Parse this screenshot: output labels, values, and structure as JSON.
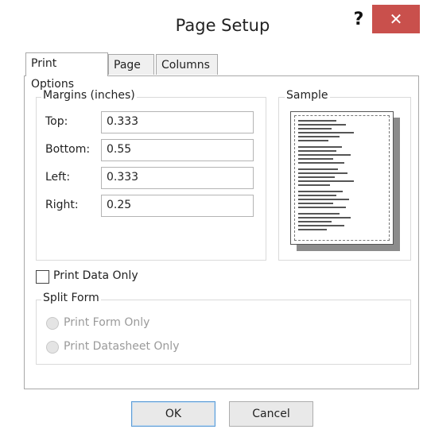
{
  "window": {
    "title": "Page Setup",
    "help_label": "?",
    "close_label": "✕"
  },
  "tabs": [
    {
      "label": "Print Options",
      "active": true
    },
    {
      "label": "Page",
      "active": false
    },
    {
      "label": "Columns",
      "active": false
    }
  ],
  "margins": {
    "group_label": "Margins (inches)",
    "fields": [
      {
        "label": "Top:",
        "value": "0.333"
      },
      {
        "label": "Bottom:",
        "value": "0.55"
      },
      {
        "label": "Left:",
        "value": "0.333"
      },
      {
        "label": "Right:",
        "value": "0.25"
      }
    ]
  },
  "sample": {
    "group_label": "Sample"
  },
  "print_data_only": {
    "label": "Print Data Only",
    "checked": false
  },
  "split_form": {
    "group_label": "Split Form",
    "options": [
      {
        "label": "Print Form Only",
        "enabled": false
      },
      {
        "label": "Print Datasheet Only",
        "enabled": false
      }
    ]
  },
  "buttons": {
    "ok_label": "OK",
    "cancel_label": "Cancel"
  }
}
